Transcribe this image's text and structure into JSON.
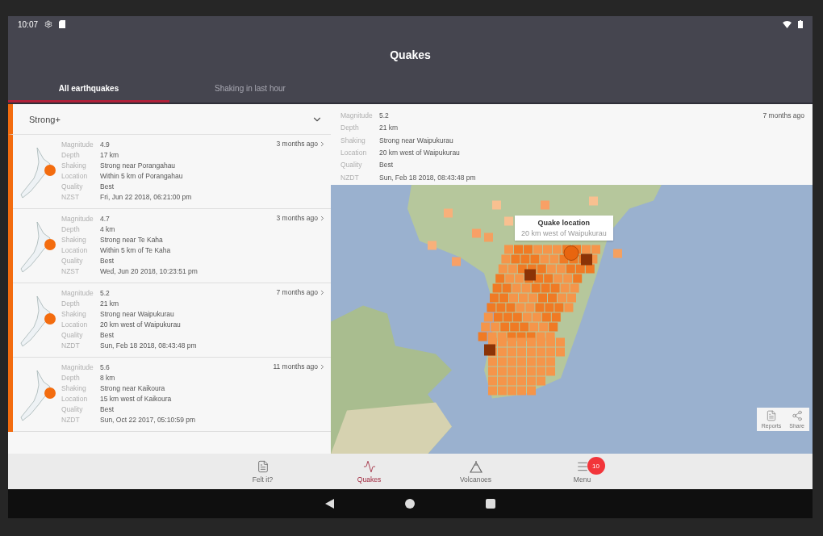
{
  "status_bar": {
    "time": "10:07"
  },
  "app_bar": {
    "title": "Quakes"
  },
  "tabs": [
    {
      "label": "All earthquakes",
      "selected": true
    },
    {
      "label": "Shaking in last hour",
      "selected": false
    }
  ],
  "filter": {
    "value": "Strong+"
  },
  "quakes": [
    {
      "age": "3 months ago",
      "fields": [
        {
          "label": "Magnitude",
          "value": "4.9"
        },
        {
          "label": "Depth",
          "value": "17 km"
        },
        {
          "label": "Shaking",
          "value": "Strong near Porangahau"
        },
        {
          "label": "Location",
          "value": "Within 5 km of Porangahau"
        },
        {
          "label": "Quality",
          "value": "Best"
        },
        {
          "label": "NZST",
          "value": "Fri, Jun 22 2018, 06:21:00 pm"
        }
      ]
    },
    {
      "age": "3 months ago",
      "fields": [
        {
          "label": "Magnitude",
          "value": "4.7"
        },
        {
          "label": "Depth",
          "value": "4 km"
        },
        {
          "label": "Shaking",
          "value": "Strong near Te Kaha"
        },
        {
          "label": "Location",
          "value": "Within 5 km of Te Kaha"
        },
        {
          "label": "Quality",
          "value": "Best"
        },
        {
          "label": "NZST",
          "value": "Wed, Jun 20 2018, 10:23:51 pm"
        }
      ]
    },
    {
      "age": "7 months ago",
      "fields": [
        {
          "label": "Magnitude",
          "value": "5.2"
        },
        {
          "label": "Depth",
          "value": "21 km"
        },
        {
          "label": "Shaking",
          "value": "Strong near Waipukurau"
        },
        {
          "label": "Location",
          "value": "20 km west of Waipukurau"
        },
        {
          "label": "Quality",
          "value": "Best"
        },
        {
          "label": "NZDT",
          "value": "Sun, Feb 18 2018, 08:43:48 pm"
        }
      ]
    },
    {
      "age": "11 months ago",
      "fields": [
        {
          "label": "Magnitude",
          "value": "5.6"
        },
        {
          "label": "Depth",
          "value": "8 km"
        },
        {
          "label": "Shaking",
          "value": "Strong near Kaikoura"
        },
        {
          "label": "Location",
          "value": "15 km west of Kaikoura"
        },
        {
          "label": "Quality",
          "value": "Best"
        },
        {
          "label": "NZDT",
          "value": "Sun, Oct 22 2017, 05:10:59 pm"
        }
      ]
    }
  ],
  "detail": {
    "age": "7 months ago",
    "fields": [
      {
        "label": "Magnitude",
        "value": "5.2"
      },
      {
        "label": "Depth",
        "value": "21 km"
      },
      {
        "label": "Shaking",
        "value": "Strong near Waipukurau"
      },
      {
        "label": "Location",
        "value": "20 km west of Waipukurau"
      },
      {
        "label": "Quality",
        "value": "Best"
      },
      {
        "label": "NZDT",
        "value": "Sun, Feb 18 2018, 08:43:48 pm"
      }
    ]
  },
  "map": {
    "callout": {
      "title": "Quake location",
      "subtitle": "20 km west of Waipukurau"
    },
    "actions": [
      {
        "kind": "reports",
        "label": "Reports"
      },
      {
        "kind": "share",
        "label": "Share"
      }
    ]
  },
  "bottom_nav": [
    {
      "kind": "felt",
      "label": "Felt it?",
      "selected": false
    },
    {
      "kind": "quakes",
      "label": "Quakes",
      "selected": true
    },
    {
      "kind": "volcanoes",
      "label": "Volcanoes",
      "selected": false
    },
    {
      "kind": "menu",
      "label": "Menu",
      "selected": false,
      "badge": "10"
    }
  ]
}
